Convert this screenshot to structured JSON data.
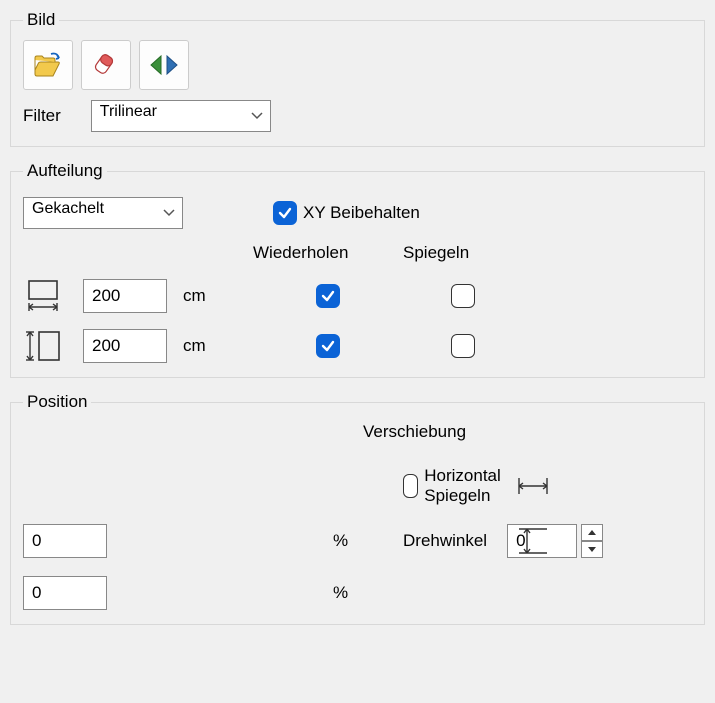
{
  "bild": {
    "legend": "Bild",
    "filter_label": "Filter",
    "filter_value": "Trilinear"
  },
  "aufteilung": {
    "legend": "Aufteilung",
    "mode_value": "Gekachelt",
    "xy_label": "XY Beibehalten",
    "xy_checked": true,
    "col_repeat": "Wiederholen",
    "col_mirror": "Spiegeln",
    "width_value": "200",
    "width_unit": "cm",
    "width_repeat": true,
    "width_mirror": false,
    "height_value": "200",
    "height_unit": "cm",
    "height_repeat": true,
    "height_mirror": false
  },
  "position": {
    "legend": "Position",
    "shift_label": "Verschiebung",
    "hmirror_label": "Horizontal Spiegeln",
    "hmirror_checked": false,
    "shift_x_value": "0",
    "shift_x_unit": "%",
    "angle_label": "Drehwinkel",
    "angle_value": "0",
    "shift_y_value": "0",
    "shift_y_unit": "%"
  }
}
